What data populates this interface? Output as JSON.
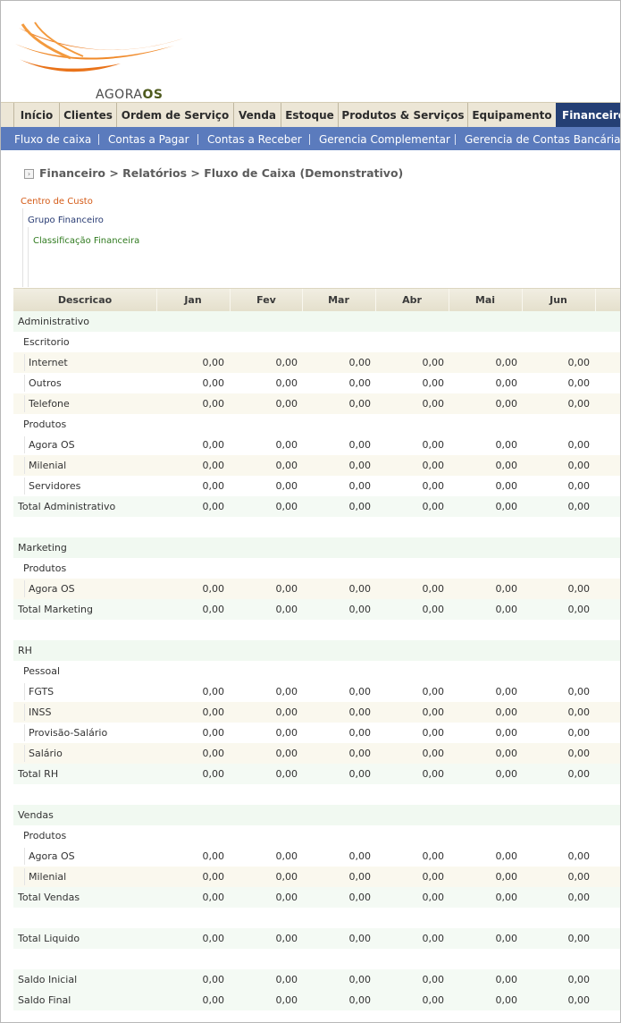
{
  "brand": {
    "logo_prefix": "AGORA",
    "logo_suffix": "OS"
  },
  "main_nav": [
    {
      "label": "Início",
      "active": false
    },
    {
      "label": "Clientes",
      "active": false
    },
    {
      "label": "Ordem de Serviço",
      "active": false
    },
    {
      "label": "Venda",
      "active": false
    },
    {
      "label": "Estoque",
      "active": false
    },
    {
      "label": "Produtos & Serviços",
      "active": false
    },
    {
      "label": "Equipamento",
      "active": false
    },
    {
      "label": "Financeiro",
      "active": true
    }
  ],
  "sub_nav": [
    "Fluxo de caixa",
    "Contas a Pagar",
    "Contas a Receber",
    "Gerencia Complementar",
    "Gerencia de Contas Bancárias"
  ],
  "breadcrumb": "Financeiro > Relatórios > Fluxo de Caixa (Demonstrativo)",
  "legend": {
    "level1": "Centro de Custo",
    "level2": "Grupo Financeiro",
    "level3": "Classificação Financeira"
  },
  "table": {
    "columns": [
      "Descricao",
      "Jan",
      "Fev",
      "Mar",
      "Abr",
      "Mai",
      "Jun"
    ],
    "rows": [
      {
        "type": "group",
        "label": "Administrativo"
      },
      {
        "type": "subgroup",
        "label": "Escritorio"
      },
      {
        "type": "item",
        "label": "Internet",
        "values": [
          "0,00",
          "0,00",
          "0,00",
          "0,00",
          "0,00",
          "0,00"
        ]
      },
      {
        "type": "item",
        "label": "Outros",
        "values": [
          "0,00",
          "0,00",
          "0,00",
          "0,00",
          "0,00",
          "0,00"
        ]
      },
      {
        "type": "item",
        "label": "Telefone",
        "values": [
          "0,00",
          "0,00",
          "0,00",
          "0,00",
          "0,00",
          "0,00"
        ]
      },
      {
        "type": "subgroup",
        "label": "Produtos"
      },
      {
        "type": "item",
        "label": "Agora OS",
        "values": [
          "0,00",
          "0,00",
          "0,00",
          "0,00",
          "0,00",
          "0,00"
        ]
      },
      {
        "type": "item",
        "label": "Milenial",
        "values": [
          "0,00",
          "0,00",
          "0,00",
          "0,00",
          "0,00",
          "0,00"
        ]
      },
      {
        "type": "item",
        "label": "Servidores",
        "values": [
          "0,00",
          "0,00",
          "0,00",
          "0,00",
          "0,00",
          "0,00"
        ]
      },
      {
        "type": "total",
        "label": "Total Administrativo",
        "values": [
          "0,00",
          "0,00",
          "0,00",
          "0,00",
          "0,00",
          "0,00"
        ]
      },
      {
        "type": "blank"
      },
      {
        "type": "group",
        "label": "Marketing"
      },
      {
        "type": "subgroup",
        "label": "Produtos"
      },
      {
        "type": "item",
        "label": "Agora OS",
        "values": [
          "0,00",
          "0,00",
          "0,00",
          "0,00",
          "0,00",
          "0,00"
        ]
      },
      {
        "type": "total",
        "label": "Total Marketing",
        "values": [
          "0,00",
          "0,00",
          "0,00",
          "0,00",
          "0,00",
          "0,00"
        ]
      },
      {
        "type": "blank"
      },
      {
        "type": "group",
        "label": "RH"
      },
      {
        "type": "subgroup",
        "label": "Pessoal"
      },
      {
        "type": "item",
        "label": "FGTS",
        "values": [
          "0,00",
          "0,00",
          "0,00",
          "0,00",
          "0,00",
          "0,00"
        ]
      },
      {
        "type": "item",
        "label": "INSS",
        "values": [
          "0,00",
          "0,00",
          "0,00",
          "0,00",
          "0,00",
          "0,00"
        ]
      },
      {
        "type": "item",
        "label": "Provisão-Salário",
        "values": [
          "0,00",
          "0,00",
          "0,00",
          "0,00",
          "0,00",
          "0,00"
        ]
      },
      {
        "type": "item",
        "label": "Salário",
        "values": [
          "0,00",
          "0,00",
          "0,00",
          "0,00",
          "0,00",
          "0,00"
        ]
      },
      {
        "type": "total",
        "label": "Total RH",
        "values": [
          "0,00",
          "0,00",
          "0,00",
          "0,00",
          "0,00",
          "0,00"
        ]
      },
      {
        "type": "blank"
      },
      {
        "type": "group",
        "label": "Vendas"
      },
      {
        "type": "subgroup",
        "label": "Produtos"
      },
      {
        "type": "item",
        "label": "Agora OS",
        "values": [
          "0,00",
          "0,00",
          "0,00",
          "0,00",
          "0,00",
          "0,00"
        ]
      },
      {
        "type": "item",
        "label": "Milenial",
        "values": [
          "0,00",
          "0,00",
          "0,00",
          "0,00",
          "0,00",
          "0,00"
        ]
      },
      {
        "type": "total",
        "label": "Total Vendas",
        "values": [
          "0,00",
          "0,00",
          "0,00",
          "0,00",
          "0,00",
          "0,00"
        ]
      },
      {
        "type": "blank"
      },
      {
        "type": "total",
        "label": "Total Liquido",
        "values": [
          "0,00",
          "0,00",
          "0,00",
          "0,00",
          "0,00",
          "0,00"
        ]
      },
      {
        "type": "blank"
      },
      {
        "type": "total",
        "label": "Saldo Inicial",
        "values": [
          "0,00",
          "0,00",
          "0,00",
          "0,00",
          "0,00",
          "0,00"
        ]
      },
      {
        "type": "total",
        "label": "Saldo Final",
        "values": [
          "0,00",
          "0,00",
          "0,00",
          "0,00",
          "0,00",
          "0,00"
        ]
      }
    ]
  },
  "colors": {
    "active_tab": "#243f74",
    "subnav": "#5b7bbd",
    "level1": "#d45a16",
    "level2": "#273a72",
    "level3": "#2f7a1e"
  }
}
